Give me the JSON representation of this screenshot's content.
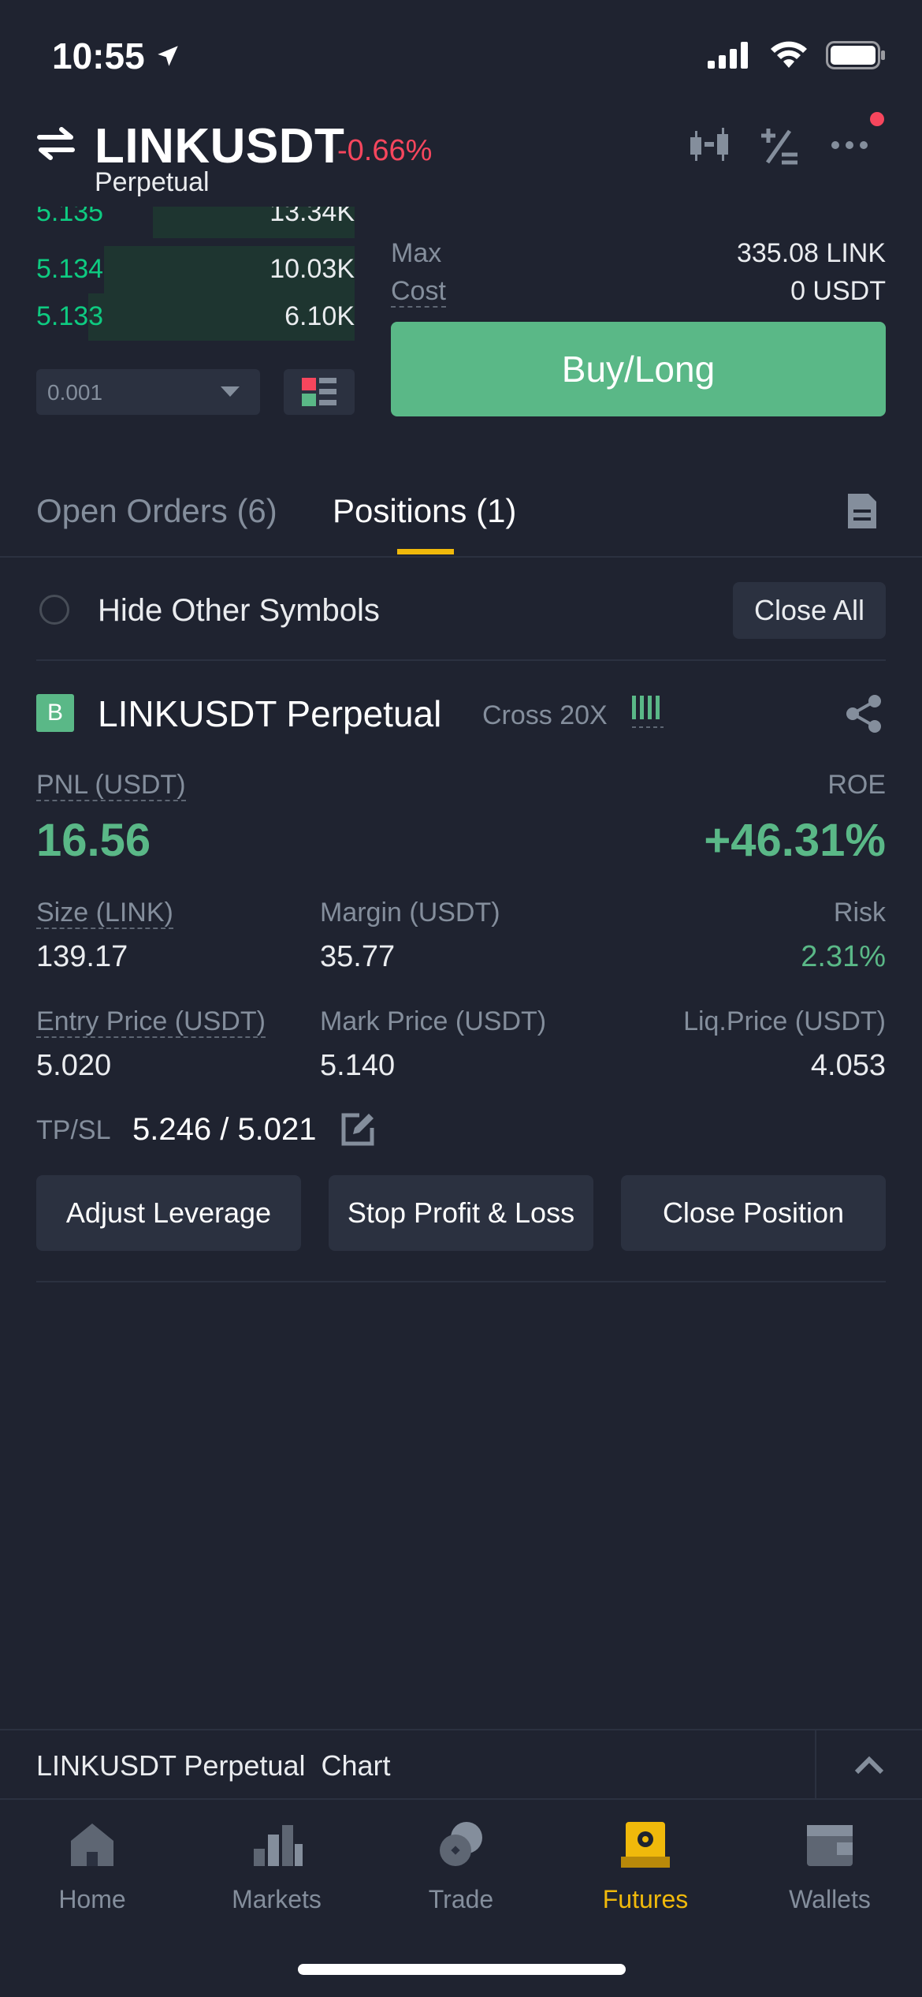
{
  "status_bar": {
    "time": "10:55"
  },
  "header": {
    "symbol": "LINKUSDT",
    "change": "-0.66%",
    "subtitle": "Perpetual"
  },
  "order_book": {
    "rows": [
      {
        "price": "5.135",
        "qty": "13.34K"
      },
      {
        "price": "5.134",
        "qty": "10.03K"
      },
      {
        "price": "5.133",
        "qty": "6.10K"
      }
    ],
    "precision": "0.001"
  },
  "order_panel": {
    "max_label": "Max",
    "max_value": "335.08 LINK",
    "cost_label": "Cost",
    "cost_value": "0 USDT",
    "buy_label": "Buy/Long"
  },
  "tabs": {
    "open_orders": "Open Orders (6)",
    "positions": "Positions (1)"
  },
  "filter": {
    "hide_label": "Hide Other Symbols",
    "close_all": "Close All"
  },
  "position": {
    "badge": "B",
    "title": "LINKUSDT Perpetual",
    "mode": "Cross 20X",
    "pnl_label": "PNL (USDT)",
    "pnl_value": "16.56",
    "roe_label": "ROE",
    "roe_value": "+46.31%",
    "size_label": "Size (LINK)",
    "size_value": "139.17",
    "margin_label": "Margin (USDT)",
    "margin_value": "35.77",
    "risk_label": "Risk",
    "risk_value": "2.31%",
    "entry_label": "Entry Price (USDT)",
    "entry_value": "5.020",
    "mark_label": "Mark Price (USDT)",
    "mark_value": "5.140",
    "liq_label": "Liq.Price (USDT)",
    "liq_value": "4.053",
    "tpsl_label": "TP/SL",
    "tpsl_value": "5.246 / 5.021",
    "buttons": [
      "Adjust Leverage",
      "Stop Profit & Loss",
      "Close Position"
    ]
  },
  "chart_bar": {
    "label": "LINKUSDT Perpetual  Chart"
  },
  "nav": {
    "items": [
      {
        "label": "Home",
        "icon": "home-icon"
      },
      {
        "label": "Markets",
        "icon": "markets-icon"
      },
      {
        "label": "Trade",
        "icon": "trade-icon"
      },
      {
        "label": "Futures",
        "icon": "futures-icon"
      },
      {
        "label": "Wallets",
        "icon": "wallet-icon"
      }
    ],
    "active": "Futures"
  },
  "colors": {
    "background": "#1f2330",
    "buy_green": "#5ab887",
    "sell_red": "#f6465d",
    "accent_yellow": "#f0b90b"
  }
}
